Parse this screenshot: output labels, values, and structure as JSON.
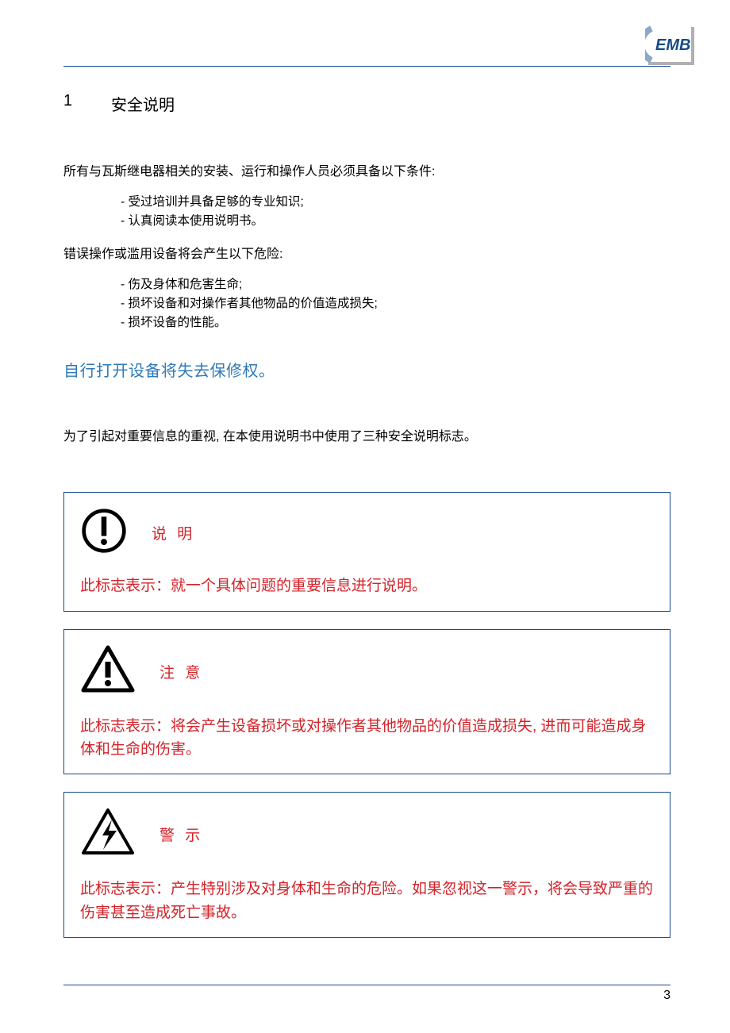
{
  "logo_text": "EMB",
  "section_number": "1",
  "section_title": "安全说明",
  "intro_paragraph": "所有与瓦斯继电器相关的安装、运行和操作人员必须具备以下条件:",
  "list1": [
    "受过培训并具备足够的专业知识;",
    "认真阅读本使用说明书。"
  ],
  "paragraph2": "错误操作或滥用设备将会产生以下危险:",
  "list2": [
    "伤及身体和危害生命;",
    "损坏设备和对操作者其他物品的价值造成损失;",
    "损坏设备的性能。"
  ],
  "blue_warning": "自行打开设备将失去保修权。",
  "paragraph3": "为了引起对重要信息的重视, 在本使用说明书中使用了三种安全说明标志。",
  "notices": [
    {
      "label": "说 明",
      "body": "此标志表示：就一个具体问题的重要信息进行说明。"
    },
    {
      "label": "注 意",
      "body": "此标志表示：将会产生设备损坏或对操作者其他物品的价值造成损失, 进而可能造成身体和生命的伤害。"
    },
    {
      "label": "警 示",
      "body": "此标志表示：产生特别涉及对身体和生命的危险。如果忽视这一警示，将会导致严重的伤害甚至造成死亡事故。"
    }
  ],
  "page_number": "3"
}
